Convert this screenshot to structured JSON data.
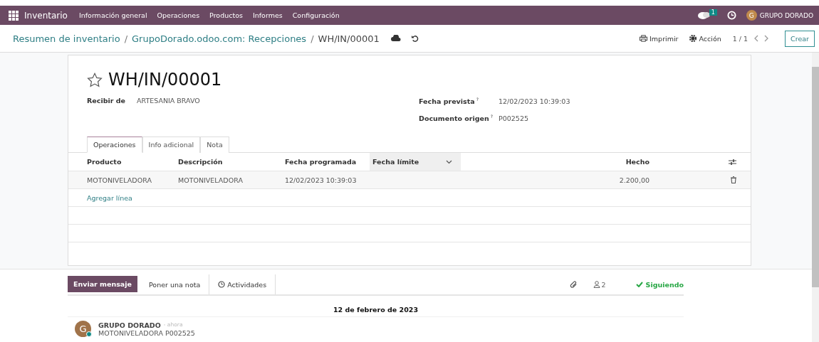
{
  "navbar": {
    "app": "Inventario",
    "menu": [
      "Información general",
      "Operaciones",
      "Productos",
      "Informes",
      "Configuración"
    ],
    "message_count": "1",
    "user_initial": "G",
    "user": "GRUPO DORADO"
  },
  "control_panel": {
    "breadcrumbs": [
      "Resumen de inventario",
      "GrupoDorado.odoo.com: Recepciones"
    ],
    "separator": "/",
    "current": "WH/IN/00001",
    "print": "Imprimir",
    "action": "Acción",
    "pager": "1 / 1",
    "create": "Crear"
  },
  "form": {
    "title": "WH/IN/00001",
    "starred": false,
    "left_fields": [
      {
        "label": "Recibir de",
        "value": "ARTESANIA BRAVO"
      }
    ],
    "right_fields": [
      {
        "label": "Fecha prevista",
        "help": "?",
        "value": "12/02/2023 10:39:03"
      },
      {
        "label": "Documento origen",
        "help": "?",
        "value": "P002525"
      }
    ],
    "tabs": [
      {
        "label": "Operaciones",
        "selected": true
      },
      {
        "label": "Info adicional",
        "selected": false
      },
      {
        "label": "Nota",
        "selected": false
      }
    ],
    "table": {
      "columns": [
        "Producto",
        "Descripción",
        "Fecha programada",
        "Fecha límite",
        "Hecho"
      ],
      "rows": [
        [
          "MOTONIVELADORA",
          "MOTONIVELADORA",
          "12/02/2023 10:39:03",
          "",
          "2.200,00"
        ]
      ],
      "add_line": "Agregar línea"
    }
  },
  "chatter": {
    "send": "Enviar mensaje",
    "note": "Poner una nota",
    "activities": "Actividades",
    "followers": "2",
    "following": "Siguiendo",
    "date": "12 de febrero de 2023",
    "messages": [
      {
        "initial": "G",
        "author": "GRUPO DORADO",
        "time": "- ahora",
        "body": "MOTONIVELADORA P002525"
      }
    ]
  }
}
